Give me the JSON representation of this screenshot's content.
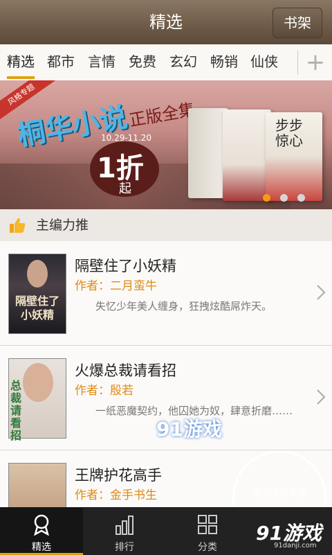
{
  "header": {
    "title": "精选",
    "shelf_label": "书架"
  },
  "tabs": [
    "精选",
    "都市",
    "言情",
    "免费",
    "玄幻",
    "畅销",
    "仙侠"
  ],
  "tab_add": "+",
  "banner": {
    "ribbon": "风格专题",
    "title": "桐华小说",
    "subtitle": "正版全集",
    "date": "10.29-11.20",
    "discount": "1折",
    "discount_suffix": "起",
    "book3_title": "步步惊心"
  },
  "section": {
    "title": "主编力推"
  },
  "books": [
    {
      "title": "隔壁住了小妖精",
      "author": "作者：二月蛮牛",
      "desc": "失忆少年美人缠身，狂拽炫酷屌炸天。",
      "cover_text": "隔壁住了小妖精"
    },
    {
      "title": "火爆总裁请看招",
      "author": "作者：殷若",
      "desc": "一纸恶魔契约，他囚她为奴，肆意折磨……",
      "cover_text": "总裁请看招"
    },
    {
      "title": "王牌护花高手",
      "author": "作者：金手书生",
      "desc": ""
    }
  ],
  "nav": [
    "精选",
    "排行",
    "分类",
    ""
  ],
  "watermark": {
    "text": "91游戏",
    "sub": "91danji.com",
    "stamp": "华为应用市场"
  }
}
